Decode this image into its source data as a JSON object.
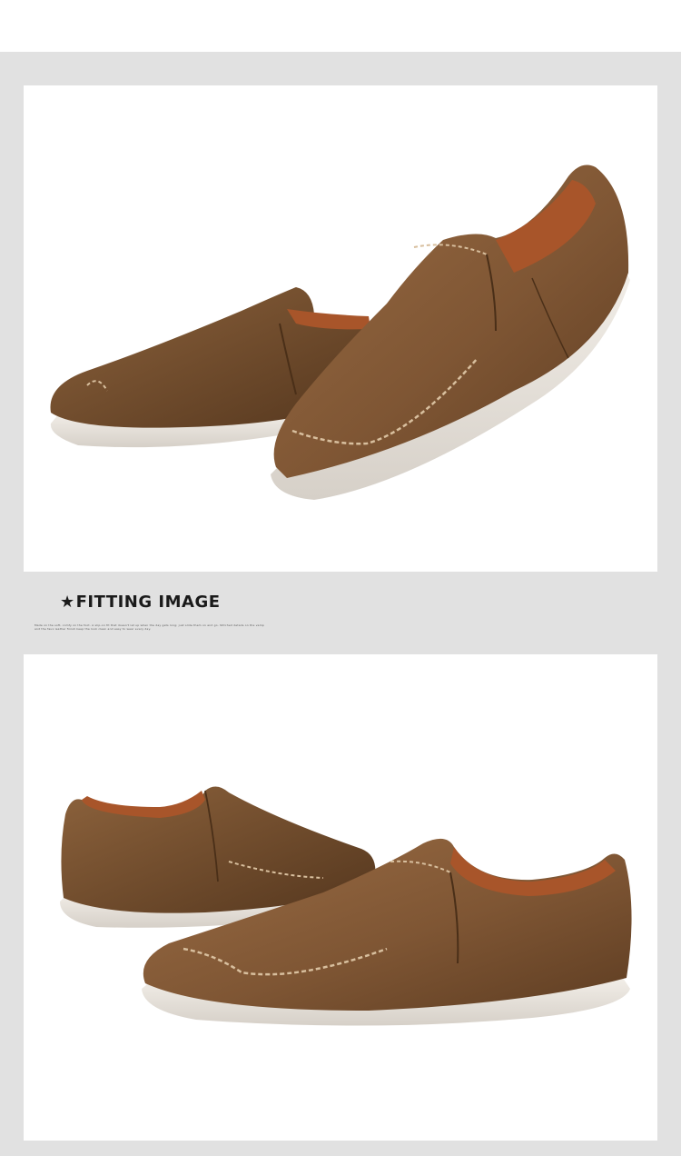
{
  "section": {
    "star": "★",
    "title": "FITTING IMAGE",
    "caption": "Made on the soft, comfy on the foot. A slip-on fit that doesn't let up when the day gets long; just slide them on and go. Stitched details on the vamp and the faux leather finish keep the look clean and easy to wear every day."
  },
  "images": [
    {
      "subject": "pair of brown slip-on loafers, elevated side view"
    },
    {
      "subject": "pair of brown slip-on loafers, side-by-side view"
    }
  ],
  "colors": {
    "background_band": "#e1e1e1",
    "panel": "#ffffff",
    "leather": "#8a5f3a",
    "leather_dark": "#5a3a20",
    "lining": "#b25a2c",
    "sole": "#e8e4de",
    "stitch": "#d8bf9e"
  }
}
